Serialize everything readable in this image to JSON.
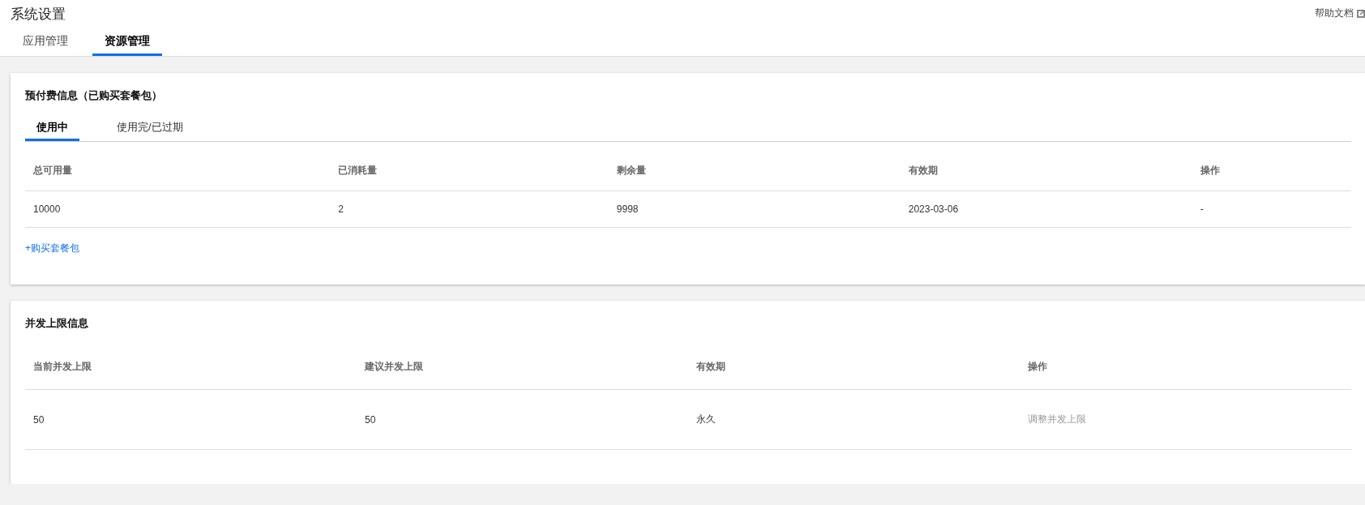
{
  "header": {
    "title": "系统设置",
    "help_link": "帮助文档"
  },
  "tabs": [
    {
      "label": "应用管理",
      "selected": false
    },
    {
      "label": "资源管理",
      "selected": true
    }
  ],
  "prepaid": {
    "title": "预付费信息（已购买套餐包）",
    "tabs": [
      {
        "label": "使用中",
        "selected": true
      },
      {
        "label": "使用完/已过期",
        "selected": false
      }
    ],
    "columns": [
      "总可用量",
      "已消耗量",
      "剩余量",
      "有效期",
      "操作"
    ],
    "rows": [
      [
        "10000",
        "2",
        "9998",
        "2023-03-06",
        "-"
      ]
    ],
    "buy_link": "+购买套餐包"
  },
  "concurrency": {
    "title": "并发上限信息",
    "columns": [
      "当前并发上限",
      "建议并发上限",
      "有效期",
      "操作"
    ],
    "rows": [
      {
        "cells": [
          "50",
          "50",
          "永久"
        ],
        "action": {
          "label": "调整并发上限",
          "disabled": true
        }
      }
    ]
  }
}
